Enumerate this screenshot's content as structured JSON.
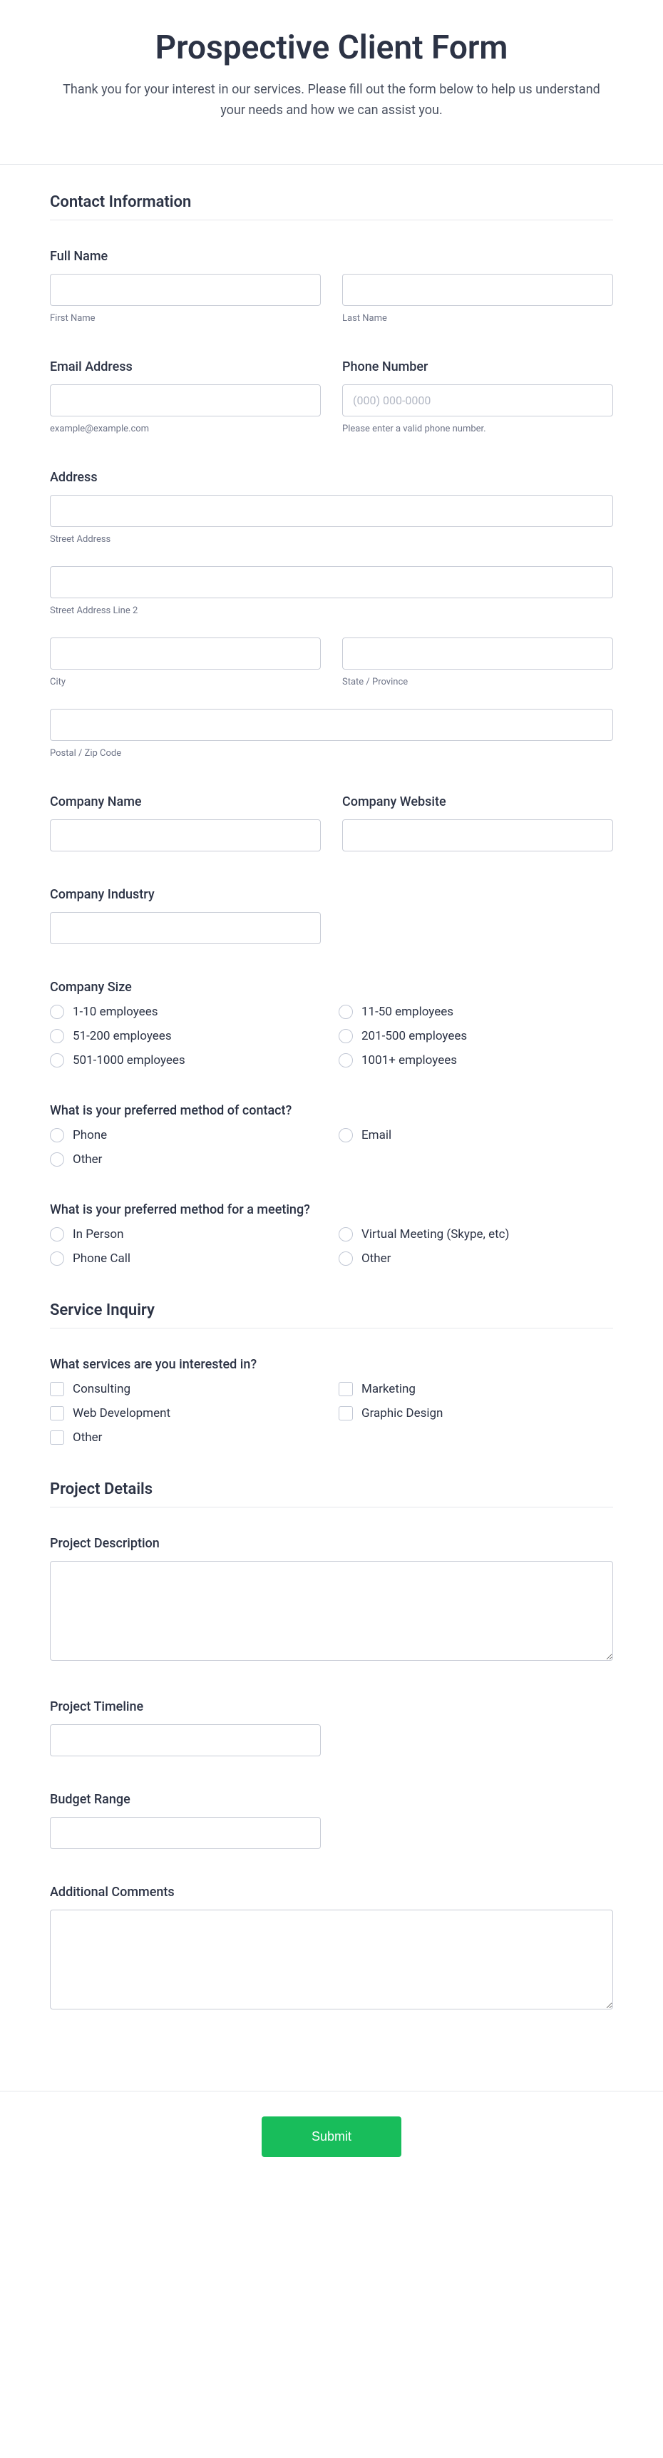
{
  "header": {
    "title": "Prospective Client Form",
    "subtitle": "Thank you for your interest in our services. Please fill out the form below to help us understand your needs and how we can assist you."
  },
  "sections": {
    "contact": "Contact Information",
    "service": "Service Inquiry",
    "project": "Project Details"
  },
  "fields": {
    "fullName": "Full Name",
    "firstName": "First Name",
    "lastName": "Last Name",
    "email": "Email Address",
    "emailHint": "example@example.com",
    "phone": "Phone Number",
    "phonePlaceholder": "(000) 000-0000",
    "phoneHint": "Please enter a valid phone number.",
    "address": "Address",
    "street1": "Street Address",
    "street2": "Street Address Line 2",
    "city": "City",
    "state": "State / Province",
    "postal": "Postal / Zip Code",
    "companyName": "Company Name",
    "companyWebsite": "Company Website",
    "companyIndustry": "Company Industry",
    "companySize": "Company Size",
    "contactMethod": "What is your preferred method of contact?",
    "meetingMethod": "What is your preferred method for a meeting?",
    "servicesQ": "What services are you interested in?",
    "projectDesc": "Project Description",
    "projectTimeline": "Project Timeline",
    "budgetRange": "Budget Range",
    "additionalComments": "Additional Comments"
  },
  "sizeOptions": [
    "1-10 employees",
    "11-50 employees",
    "51-200 employees",
    "201-500 employees",
    "501-1000 employees",
    "1001+ employees"
  ],
  "contactOptions": [
    "Phone",
    "Email",
    "Other"
  ],
  "meetingOptions": [
    "In Person",
    "Virtual Meeting (Skype, etc)",
    "Phone Call",
    "Other"
  ],
  "serviceOptions": [
    "Consulting",
    "Marketing",
    "Web Development",
    "Graphic Design",
    "Other"
  ],
  "submit": "Submit"
}
